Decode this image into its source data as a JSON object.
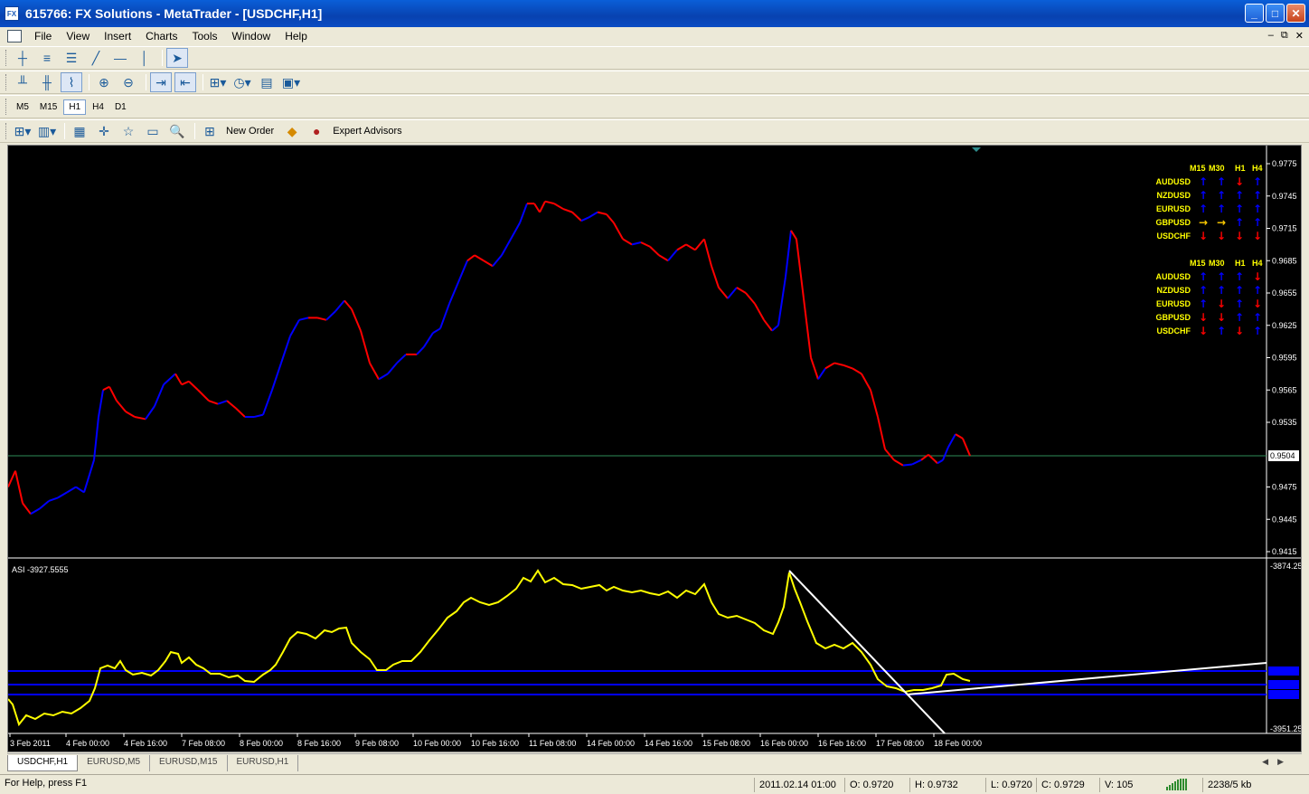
{
  "window": {
    "title": "615766: FX Solutions - MetaTrader - [USDCHF,H1]",
    "icon_text": "FX"
  },
  "menu": [
    "File",
    "View",
    "Insert",
    "Charts",
    "Tools",
    "Window",
    "Help"
  ],
  "timeframes": [
    "M5",
    "M15",
    "H1",
    "H4",
    "D1"
  ],
  "selected_timeframe": "H1",
  "toolbar": {
    "new_order": "New Order",
    "expert_advisors": "Expert Advisors"
  },
  "chart": {
    "symbol": "USDCHF,H1",
    "price_ticks": [
      "0.9775",
      "0.9745",
      "0.9715",
      "0.9685",
      "0.9655",
      "0.9625",
      "0.9595",
      "0.9565",
      "0.9535",
      "0.9475",
      "0.9445",
      "0.9415"
    ],
    "current_price": "0.9504",
    "time_labels": [
      "3 Feb 2011",
      "4 Feb 00:00",
      "4 Feb 16:00",
      "7 Feb 08:00",
      "8 Feb 00:00",
      "8 Feb 16:00",
      "9 Feb 08:00",
      "10 Feb 00:00",
      "10 Feb 16:00",
      "11 Feb 08:00",
      "14 Feb 00:00",
      "14 Feb 16:00",
      "15 Feb 08:00",
      "16 Feb 00:00",
      "16 Feb 16:00",
      "17 Feb 08:00",
      "18 Feb 00:00"
    ],
    "indicator_label": "ASI -3927.5555",
    "indicator_ticks": [
      "-3874.25",
      "-3951.25"
    ],
    "colors": {
      "up": "#0000ff",
      "down": "#ff0000",
      "asi": "#ffff00",
      "trendline": "#ffffff",
      "level": "#0000ff",
      "price_line": "#2e8b57",
      "labels": "#ffff00",
      "arrow_side": "#ffcc00"
    }
  },
  "matrix": {
    "headers": [
      "M15",
      "M30",
      "H1",
      "H4"
    ],
    "tables": [
      {
        "rows": [
          {
            "pair": "AUDUSD",
            "dirs": [
              "up",
              "up",
              "down",
              "up"
            ]
          },
          {
            "pair": "NZDUSD",
            "dirs": [
              "up",
              "up",
              "up",
              "up"
            ]
          },
          {
            "pair": "EURUSD",
            "dirs": [
              "up",
              "up",
              "up",
              "up"
            ]
          },
          {
            "pair": "GBPUSD",
            "dirs": [
              "side",
              "side",
              "up",
              "up"
            ]
          },
          {
            "pair": "USDCHF",
            "dirs": [
              "down",
              "down",
              "down",
              "down"
            ]
          }
        ]
      },
      {
        "rows": [
          {
            "pair": "AUDUSD",
            "dirs": [
              "up",
              "up",
              "up",
              "down"
            ]
          },
          {
            "pair": "NZDUSD",
            "dirs": [
              "up",
              "up",
              "up",
              "up"
            ]
          },
          {
            "pair": "EURUSD",
            "dirs": [
              "up",
              "down",
              "up",
              "down"
            ]
          },
          {
            "pair": "GBPUSD",
            "dirs": [
              "down",
              "down",
              "up",
              "up"
            ]
          },
          {
            "pair": "USDCHF",
            "dirs": [
              "down",
              "up",
              "down",
              "up"
            ]
          }
        ]
      }
    ]
  },
  "tabs": [
    "USDCHF,H1",
    "EURUSD,M5",
    "EURUSD,M15",
    "EURUSD,H1"
  ],
  "active_tab": "USDCHF,H1",
  "status": {
    "help": "For Help, press F1",
    "datetime": "2011.02.14 01:00",
    "open": "O: 0.9720",
    "high": "H: 0.9732",
    "low": "L: 0.9720",
    "close": "C: 0.9729",
    "volume": "V: 105",
    "traffic": "2238/5 kb"
  }
}
